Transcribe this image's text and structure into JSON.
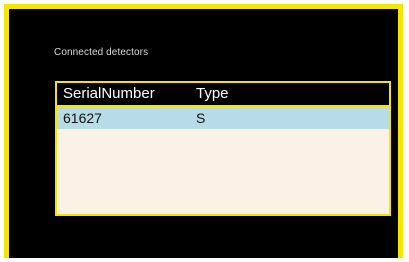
{
  "panel": {
    "title": "Connected detectors"
  },
  "table": {
    "columns": [
      "SerialNumber",
      "Type"
    ],
    "rows": [
      [
        "61627",
        "S"
      ]
    ],
    "selected_row": 0
  },
  "colors": {
    "border_accent": "#f5e600",
    "panel_background": "#000000",
    "table_background": "#fcf1e5",
    "selected_row": "#b8dbe8"
  }
}
